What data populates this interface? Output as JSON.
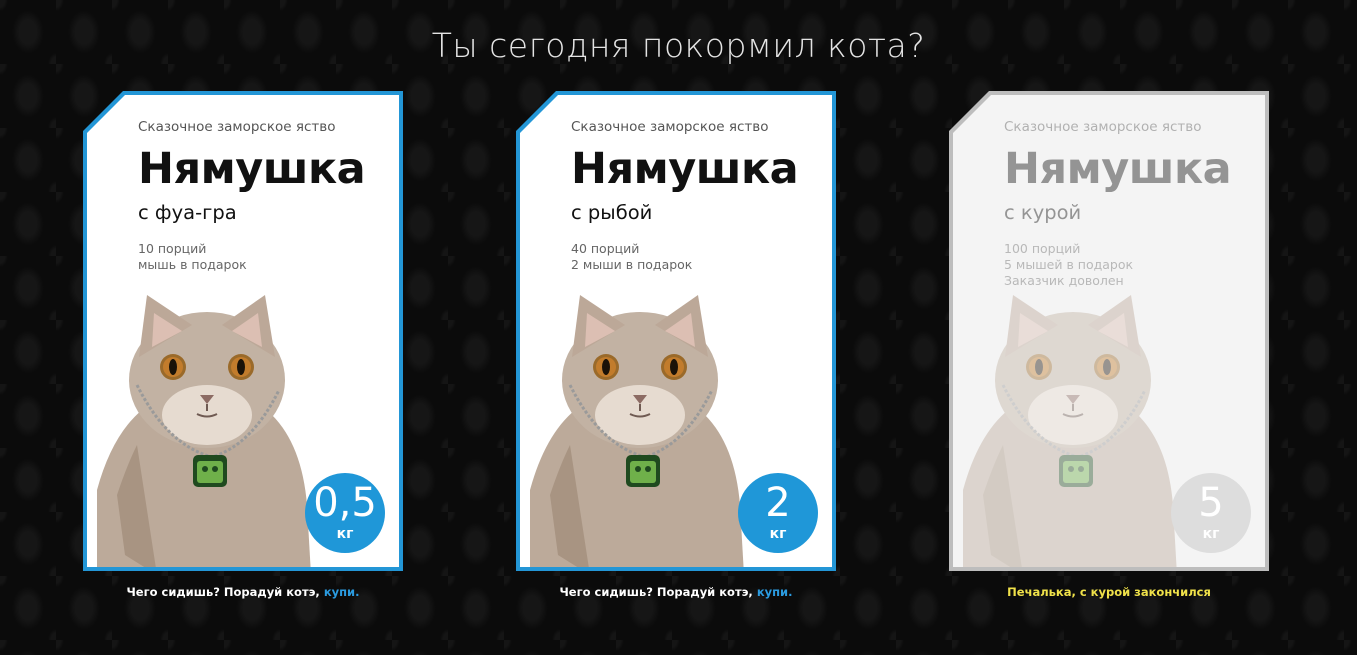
{
  "page": {
    "heading": "Ты сегодня покормил кота?"
  },
  "cards": [
    {
      "tagline": "Сказочное заморское яство",
      "brand": "Нямушка",
      "flavor": "с фуа-гра",
      "details": [
        "10 порций",
        "мышь в подарок"
      ],
      "weight_value": "0,5",
      "weight_unit": "кг",
      "caption_text": "Чего сидишь? Порадуй котэ, ",
      "caption_link": "купи.",
      "state": "available"
    },
    {
      "tagline": "Сказочное заморское яство",
      "brand": "Нямушка",
      "flavor": "с рыбой",
      "details": [
        "40 порций",
        "2 мыши в подарок"
      ],
      "weight_value": "2",
      "weight_unit": "кг",
      "caption_text": "Чего сидишь? Порадуй котэ, ",
      "caption_link": "купи.",
      "state": "available"
    },
    {
      "tagline": "Сказочное заморское яство",
      "brand": "Нямушка",
      "flavor": "с курой",
      "details": [
        "100 порций",
        "5 мышей в подарок",
        "Заказчик доволен"
      ],
      "weight_value": "5",
      "weight_unit": "кг",
      "caption_text": "Печалька, с курой закончился",
      "state": "disabled"
    }
  ],
  "colors": {
    "accent": "#1f97d8",
    "link": "#2b9be0",
    "sold_out_text": "#f0e24a",
    "disabled_border": "#bdbdbd",
    "background": "#0b0b0b"
  },
  "icons": {
    "pet_tag": "cat-face-tag-icon"
  }
}
